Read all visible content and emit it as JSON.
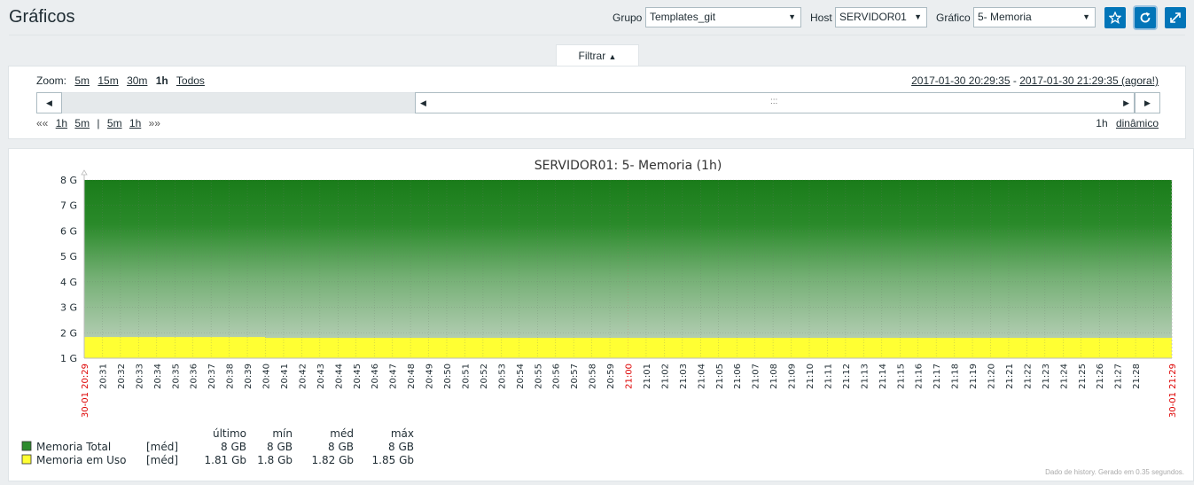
{
  "header": {
    "title": "Gráficos",
    "group_label": "Grupo",
    "group_value": "Templates_git",
    "host_label": "Host",
    "host_value": "SERVIDOR01",
    "graph_label": "Gráfico",
    "graph_value": "5- Memoria",
    "buttons": [
      "star-icon",
      "refresh-icon",
      "fullscreen-icon"
    ],
    "accent_color": "#0275b8"
  },
  "filter": {
    "tab_label": "Filtrar",
    "zoom_label": "Zoom:",
    "zoom_options": [
      "5m",
      "15m",
      "30m",
      "1h",
      "Todos"
    ],
    "zoom_active": "1h",
    "period_start": "2017-01-30 20:29:35",
    "period_separator": "-",
    "period_end": "2017-01-30 21:29:35 (agora!)",
    "nav_back_fast": "««",
    "nav_back": [
      "1h",
      "5m"
    ],
    "nav_separator": "|",
    "nav_forward": [
      "5m",
      "1h"
    ],
    "nav_forward_fast": "»»",
    "period_length": "1h",
    "dynamic_label": "dinâmico"
  },
  "chart_data": {
    "type": "area",
    "title": "SERVIDOR01: 5- Memoria (1h)",
    "ylim": [
      1,
      8
    ],
    "y_unit": "G",
    "yticks": [
      "8 G",
      "7 G",
      "6 G",
      "5 G",
      "4 G",
      "3 G",
      "2 G",
      "1 G"
    ],
    "x_start_label": "30-01 20:29",
    "x_end_label": "30-01 21:29",
    "x_ticks": [
      "20:31",
      "20:32",
      "20:33",
      "20:34",
      "20:35",
      "20:36",
      "20:37",
      "20:38",
      "20:39",
      "20:40",
      "20:41",
      "20:42",
      "20:43",
      "20:44",
      "20:45",
      "20:46",
      "20:47",
      "20:48",
      "20:49",
      "20:50",
      "20:51",
      "20:52",
      "20:53",
      "20:54",
      "20:55",
      "20:56",
      "20:57",
      "20:58",
      "20:59",
      "21:00",
      "21:01",
      "21:02",
      "21:03",
      "21:04",
      "21:05",
      "21:06",
      "21:07",
      "21:08",
      "21:09",
      "21:10",
      "21:11",
      "21:12",
      "21:13",
      "21:14",
      "21:15",
      "21:16",
      "21:17",
      "21:18",
      "21:19",
      "21:20",
      "21:21",
      "21:22",
      "21:23",
      "21:24",
      "21:25",
      "21:26",
      "21:27",
      "21:28"
    ],
    "x_highlight": [
      "21:00"
    ],
    "series": [
      {
        "name": "Memoria Total",
        "color": "#1a7c1a",
        "values": [
          8,
          8
        ]
      },
      {
        "name": "Memoria em Uso",
        "color": "#ffff33",
        "x": [
          0,
          10,
          10,
          60
        ],
        "values": [
          1.83,
          1.83,
          1.8,
          1.8
        ]
      }
    ],
    "legend": {
      "headers": [
        "último",
        "mín",
        "méd",
        "máx"
      ],
      "rows": [
        {
          "name": "Memoria Total",
          "func": "[méd]",
          "last": "8 GB",
          "min": "8 GB",
          "avg": "8 GB",
          "max": "8 GB",
          "color": "#2e8b2e"
        },
        {
          "name": "Memoria em Uso",
          "func": "[méd]",
          "last": "1.81 Gb",
          "min": "1.8 Gb",
          "avg": "1.82 Gb",
          "max": "1.85 Gb",
          "color": "#ffff33"
        }
      ]
    },
    "footnote": "Dado de history. Gerado em 0.35 segundos."
  }
}
